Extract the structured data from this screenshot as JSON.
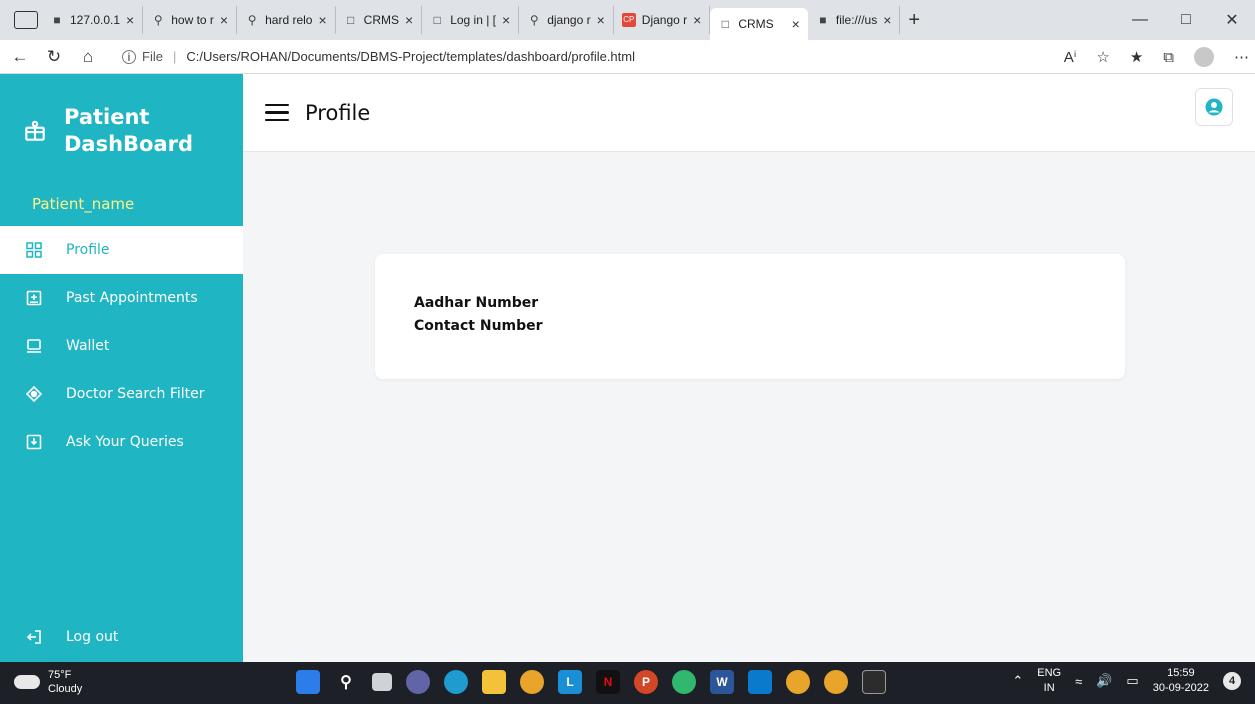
{
  "browser": {
    "tabs": [
      {
        "label": "127.0.0.1",
        "icon": "page-icon"
      },
      {
        "label": "how to r",
        "icon": "search-icon"
      },
      {
        "label": "hard relo",
        "icon": "search-icon"
      },
      {
        "label": "CRMS",
        "icon": "page-icon"
      },
      {
        "label": "Log in | [",
        "icon": "page-icon"
      },
      {
        "label": "django r",
        "icon": "search-icon"
      },
      {
        "label": "Django r",
        "icon": "cp-icon"
      },
      {
        "label": "CRMS",
        "icon": "page-icon",
        "active": true
      },
      {
        "label": "file:///us",
        "icon": "page-icon"
      }
    ],
    "address": {
      "scheme_label": "File",
      "url": "C:/Users/ROHAN/Documents/DBMS-Project/templates/dashboard/profile.html"
    }
  },
  "sidebar": {
    "brand_line1": "Patient",
    "brand_line2": "DashBoard",
    "patient_name": "Patient_name",
    "items": [
      {
        "label": "Profile",
        "icon": "grid-icon",
        "active": true
      },
      {
        "label": "Past Appointments",
        "icon": "plus-box-icon"
      },
      {
        "label": "Wallet",
        "icon": "laptop-icon"
      },
      {
        "label": "Doctor Search Filter",
        "icon": "target-icon"
      },
      {
        "label": "Ask Your Queries",
        "icon": "download-box-icon"
      }
    ],
    "logout_label": "Log out"
  },
  "header": {
    "title": "Profile"
  },
  "profile_card": {
    "aadhar_label": "Aadhar Number",
    "contact_label": "Contact Number"
  },
  "taskbar": {
    "temperature": "75°F",
    "weather": "Cloudy",
    "lang_line1": "ENG",
    "lang_line2": "IN",
    "time": "15:59",
    "date": "30-09-2022",
    "notification_count": "4"
  },
  "colors": {
    "sidebar": "#1fb5c2",
    "patient_name": "#fff48a"
  }
}
